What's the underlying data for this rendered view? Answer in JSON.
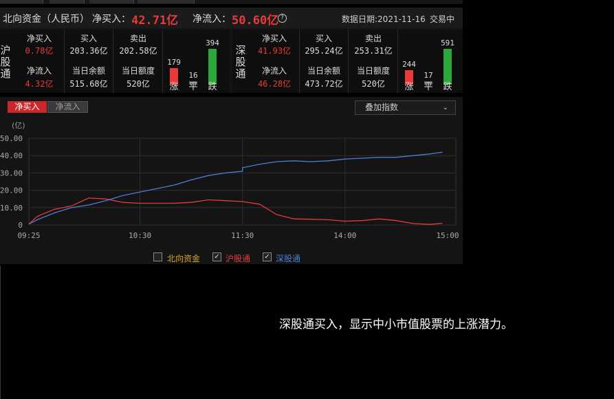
{
  "header": {
    "title": "北向资金（人民币）",
    "net_buy_label": "净买入：",
    "net_buy_value": "42.71亿",
    "net_inflow_label": "净流入：",
    "net_inflow_value": "50.60亿",
    "data_date": "数据日期:2021-11-16",
    "status": "交易中"
  },
  "sh": {
    "name": "沪股通",
    "net_buy_label": "净买入",
    "net_buy_value": "0.78亿",
    "buy_label": "买入",
    "buy_value": "203.36亿",
    "sell_label": "卖出",
    "sell_value": "202.58亿",
    "net_inflow_label": "净流入",
    "net_inflow_value": "4.32亿",
    "balance_label": "当日余额",
    "balance_value": "515.68亿",
    "quota_label": "当日额度",
    "quota_value": "520亿",
    "up": 179,
    "flat": 16,
    "down": 394,
    "up_label": "涨",
    "flat_label": "平",
    "down_label": "跌"
  },
  "sz": {
    "name": "深股通",
    "net_buy_label": "净买入",
    "net_buy_value": "41.93亿",
    "buy_label": "买入",
    "buy_value": "295.24亿",
    "sell_label": "卖出",
    "sell_value": "253.31亿",
    "net_inflow_label": "净流入",
    "net_inflow_value": "46.28亿",
    "balance_label": "当日余额",
    "balance_value": "473.72亿",
    "quota_label": "当日额度",
    "quota_value": "520亿",
    "up": 244,
    "flat": 17,
    "down": 591,
    "up_label": "涨",
    "flat_label": "平",
    "down_label": "跌"
  },
  "tabs": {
    "net_buy": "净买入",
    "net_inflow": "净流入"
  },
  "overlay_dropdown": "叠加指数",
  "legend": {
    "north": "北向资金",
    "sh": "沪股通",
    "sz": "深股通"
  },
  "colors": {
    "red": "#e83a3a",
    "blue": "#4a7fd6",
    "green": "#2aa83a",
    "gold": "#d9a520"
  },
  "chart_data": {
    "type": "line",
    "ylabel": "(亿)",
    "yticks": [
      "50.00",
      "40.00",
      "30.00",
      "20.00",
      "10.00",
      "0"
    ],
    "xticks": [
      "09:25",
      "10:30",
      "11:30",
      "14:00",
      "15:00"
    ],
    "ylim": [
      0,
      50
    ],
    "grid": true,
    "x": [
      "09:25",
      "09:30",
      "09:40",
      "09:50",
      "10:00",
      "10:10",
      "10:20",
      "10:30",
      "10:40",
      "10:50",
      "11:00",
      "11:10",
      "11:20",
      "11:30",
      "13:00",
      "13:10",
      "13:20",
      "13:30",
      "13:40",
      "13:50",
      "14:00",
      "14:10",
      "14:20",
      "14:30",
      "14:40",
      "14:50",
      "14:57"
    ],
    "series": [
      {
        "name": "沪股通",
        "color": "#e83a3a",
        "values": [
          0.5,
          5,
          9,
          11,
          15.5,
          15,
          13,
          12.5,
          12.5,
          12.5,
          13,
          14.5,
          14,
          13.5,
          13.5,
          12,
          6,
          3.5,
          3.3,
          3,
          2.2,
          2.5,
          3.5,
          2.5,
          0.8,
          0.3,
          1
        ]
      },
      {
        "name": "深股通",
        "color": "#4a7fd6",
        "values": [
          0.5,
          3,
          7,
          10,
          11.5,
          14,
          17,
          19,
          21,
          23,
          26,
          28.5,
          30,
          31,
          33,
          35,
          36.5,
          37,
          36.5,
          37,
          38,
          38.5,
          39,
          39,
          40,
          41,
          42
        ]
      }
    ]
  },
  "caption": "深股通买入，显示中小市值股票的上涨潜力。"
}
